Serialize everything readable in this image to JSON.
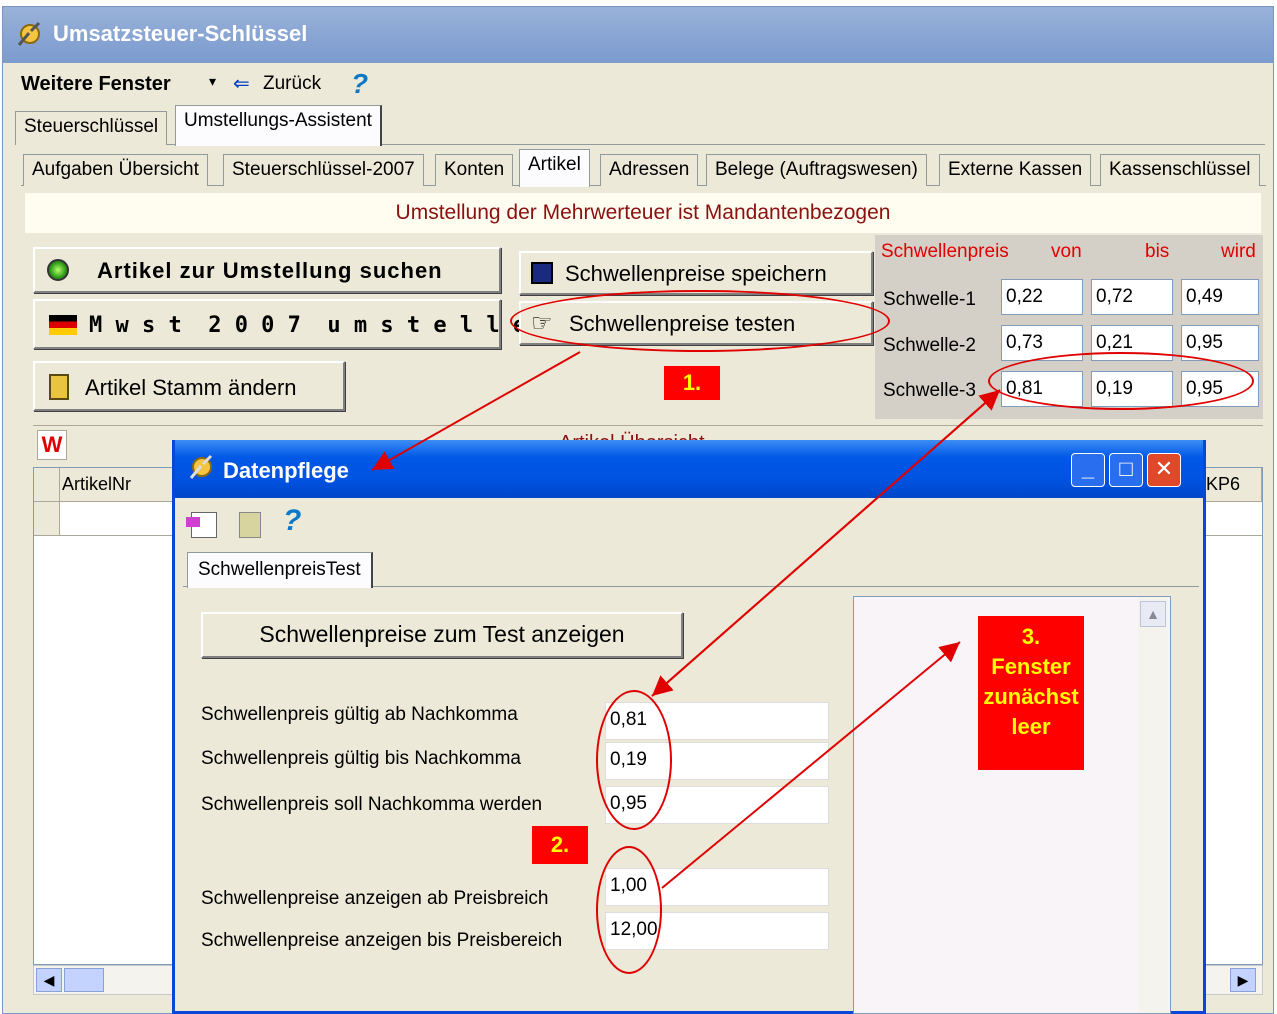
{
  "main_window": {
    "title": "Umsatzsteuer-Schlüssel",
    "menu": {
      "more_windows": "Weitere Fenster",
      "back": "Zurück",
      "help": "?"
    },
    "top_tabs": [
      "Steuerschlüssel",
      "Umstellungs-Assistent"
    ],
    "sub_tabs": [
      "Aufgaben Übersicht",
      "Steuerschlüssel-2007",
      "Konten",
      "Artikel",
      "Adressen",
      "Belege (Auftragswesen)",
      "Externe Kassen",
      "Kassenschlüssel"
    ],
    "info_banner": "Umstellung der Mehrwerteuer ist Mandantenbezogen",
    "buttons": {
      "search_articles": "Artikel zur Umstellung suchen",
      "switch_vat": "M w s t  2 0 0 7  u m s t e l l e n",
      "change_master": "Artikel Stamm ändern",
      "save_thresholds": "Schwellenpreise speichern",
      "test_thresholds": "Schwellenpreise testen"
    },
    "threshold_table": {
      "header": {
        "label": "Schwellenpreis",
        "from": "von",
        "to": "bis",
        "becomes": "wird"
      },
      "rows": [
        {
          "label": "Schwelle-1",
          "from": "0,22",
          "to": "0,72",
          "becomes": "0,49"
        },
        {
          "label": "Schwelle-2",
          "from": "0,73",
          "to": "0,21",
          "becomes": "0,95"
        },
        {
          "label": "Schwelle-3",
          "from": "0,81",
          "to": "0,19",
          "becomes": "0,95"
        }
      ]
    },
    "grid": {
      "w_icon": "W",
      "section_title": "Artikel Übersicht",
      "columns": [
        "ArtikelNr",
        "KP6"
      ]
    }
  },
  "dialog": {
    "title": "Datenpflege",
    "help": "?",
    "tab": "SchwellenpreisTest",
    "show_button": "Schwellenpreise zum Test anzeigen",
    "fields": [
      {
        "label": "Schwellenpreis gültig ab Nachkomma",
        "value": "0,81"
      },
      {
        "label": "Schwellenpreis gültig bis Nachkomma",
        "value": "0,19"
      },
      {
        "label": "Schwellenpreis soll Nachkomma werden",
        "value": "0,95"
      },
      {
        "label": "Schwellenpreise anzeigen ab Preisbreich",
        "value": "1,00"
      },
      {
        "label": "Schwellenpreise anzeigen bis Preisbereich",
        "value": "12,00"
      }
    ]
  },
  "annotations": {
    "step1": "1.",
    "step2": "2.",
    "step3_lines": [
      "3.",
      "Fenster",
      "zunächst",
      "leer"
    ]
  },
  "colors": {
    "banner_text": "#8b0000",
    "annotation_red": "#ff0000",
    "annotation_yellow": "#ffff00",
    "xp_blue": "#0054e3"
  }
}
